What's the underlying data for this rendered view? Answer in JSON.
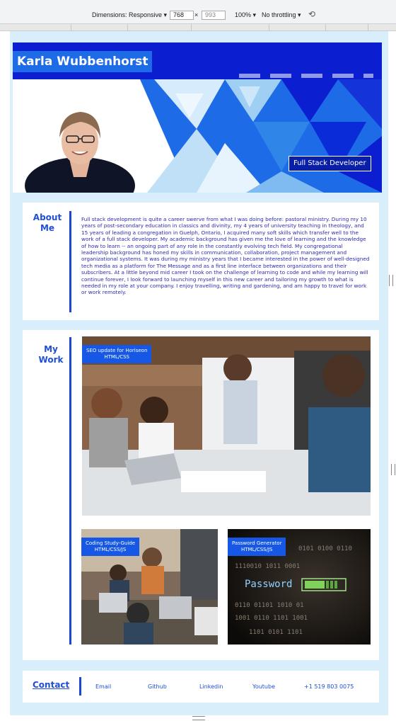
{
  "devtools": {
    "dimensions_label": "Dimensions: Responsive ▾",
    "width_value": "768",
    "times": "×",
    "height_value": "993",
    "zoom": "100% ▾",
    "throttling": "No throttling ▾",
    "rotate_icon": "rotate-icon"
  },
  "header": {
    "name": "Karla Wubbenhorst"
  },
  "hero": {
    "badge": "Full Stack Developer",
    "colors": {
      "dark_blue": "#0b1ed0",
      "mid_blue": "#1e6be8",
      "light_blue": "#7fbbf0"
    }
  },
  "about": {
    "heading_line1": "About",
    "heading_line2": "Me",
    "text": "Full stack development is quite a career swerve from what I was doing before: pastoral ministry. During my 10 years of post-secondary education in classics and divinity, my 4 years of university teaching in theology, and 15 years of leading a congregation in Guelph, Ontario, I acquired many soft skills which transfer well to the work of a full stack developer. My academic background has given me the love of learning and the knowledge of how to learn -- an ongoing part of any role in the constantly evolving tech field. My congregational leadership background has honed my skills in communication, collaboration, project management and organizational systems. It was during my ministry years that I became interested in the power of well-designed tech media as a platform for The Message and as a first line interface between organizations and their subscribers. At a little beyond mid career I took on the challenge of learning to code and while my learning will continue forever, I look forward to launching myself in this new career and tailoring my growth to what is needed in my role at your company. I enjoy travelling, writing and gardening, and am happy to travel for work or work remotely."
  },
  "work": {
    "heading_line1": "My",
    "heading_line2": "Work",
    "projects": [
      {
        "title": "SEO update for Horiseon",
        "tech": "HTML/CSS"
      },
      {
        "title": "Coding Study-Guide",
        "tech": "HTML/CSS/JS"
      },
      {
        "title": "Password Generator",
        "tech": "HTML/CSS/JS"
      }
    ],
    "password_word": "Password"
  },
  "contact": {
    "title": "Contact",
    "links": [
      "Email",
      "Github",
      "Linkedin",
      "Youtube",
      "+1 519 803 0075"
    ]
  }
}
